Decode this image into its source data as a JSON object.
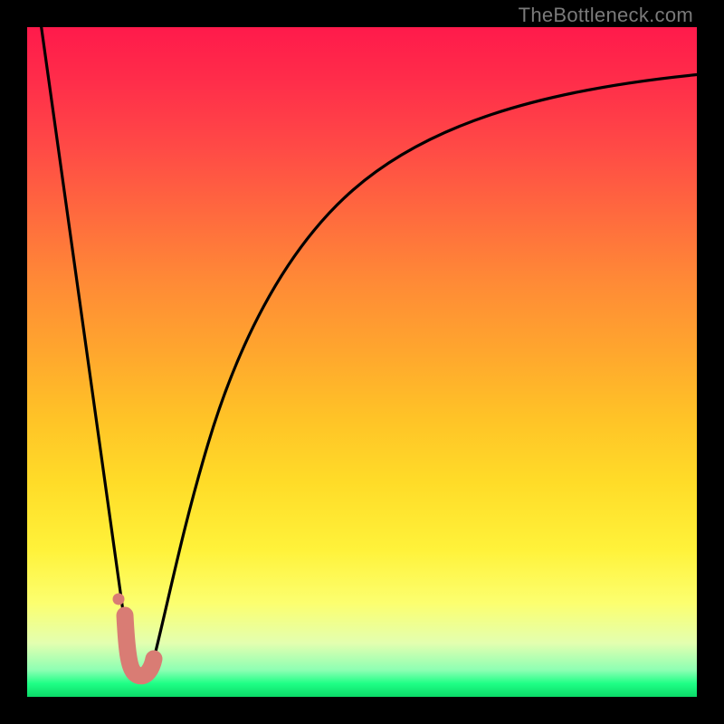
{
  "watermark": "TheBottleneck.com",
  "chart_data": {
    "type": "line",
    "title": "",
    "xlabel": "",
    "ylabel": "",
    "xlim": [
      0,
      100
    ],
    "ylim": [
      0,
      100
    ],
    "series": [
      {
        "name": "left-descent",
        "x": [
          2,
          15.5
        ],
        "y": [
          100,
          4
        ]
      },
      {
        "name": "right-ascent",
        "x": [
          18.5,
          22,
          26,
          32,
          40,
          50,
          62,
          76,
          88,
          100
        ],
        "y": [
          4,
          20,
          38,
          55,
          68,
          77,
          83.5,
          88,
          91,
          93
        ]
      },
      {
        "name": "valley-marker",
        "x": [
          14.5,
          15,
          16,
          17,
          18,
          18.5
        ],
        "y": [
          12,
          7,
          3.5,
          3.2,
          4,
          5.5
        ]
      },
      {
        "name": "left-dots",
        "x": [
          13.8,
          14.6
        ],
        "y": [
          14.5,
          9.5
        ]
      }
    ],
    "gradient_note": "vertical hue gradient red→green encodes bottleneck severity (top=worst, bottom=best)"
  }
}
